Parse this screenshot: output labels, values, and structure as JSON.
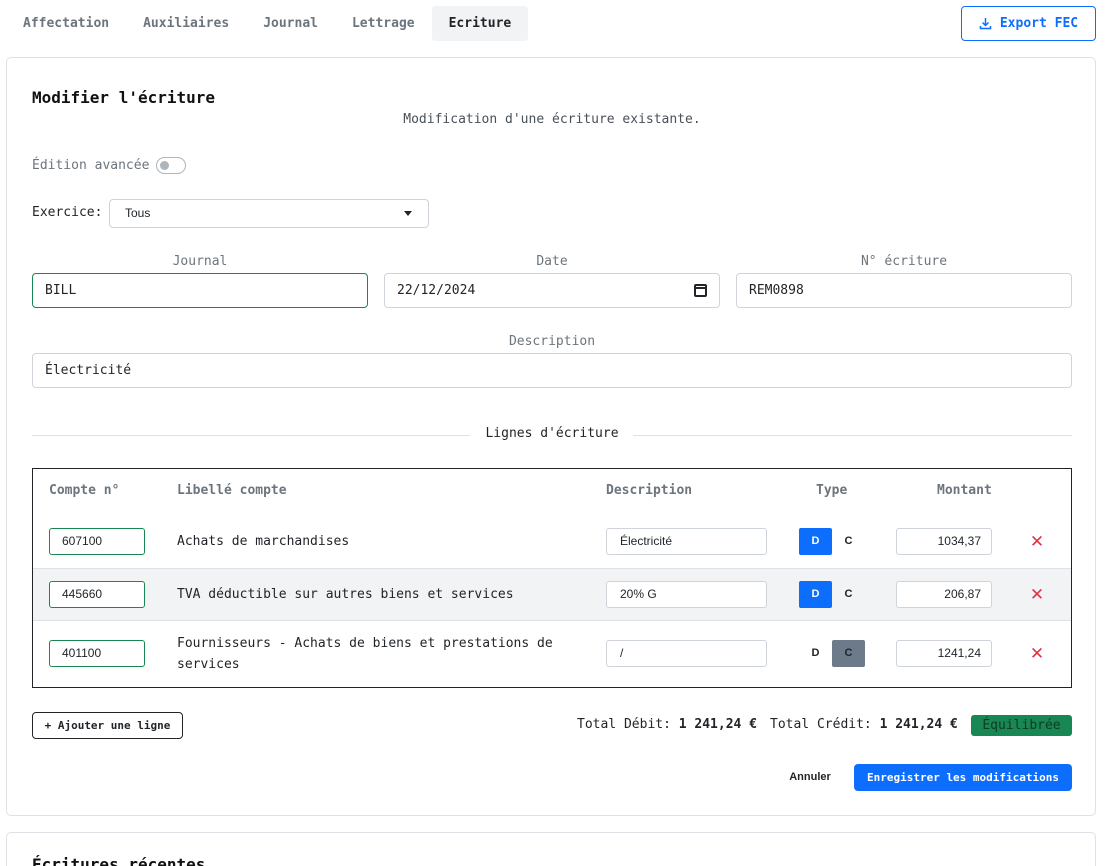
{
  "tabs": [
    "Affectation",
    "Auxiliaires",
    "Journal",
    "Lettrage",
    "Ecriture"
  ],
  "active_tab": "Ecriture",
  "export_label": "Export FEC",
  "form": {
    "title": "Modifier l'écriture",
    "subtitle": "Modification d'une écriture existante.",
    "advanced_label": "Édition avancée",
    "exercice_label": "Exercice:",
    "exercice_value": "Tous",
    "journal_label": "Journal",
    "journal_value": "BILL",
    "date_label": "Date",
    "date_value": "22/12/2024",
    "num_label": "N° écriture",
    "num_value": "REM0898",
    "description_label": "Description",
    "description_value": "Électricité",
    "lines_label": "Lignes d'écriture"
  },
  "table": {
    "headers": [
      "Compte n°",
      "Libellé compte",
      "Description",
      "Type",
      "Montant"
    ],
    "rows": [
      {
        "compte": "607100",
        "libelle": "Achats de marchandises",
        "description": "Électricité",
        "type_selected": "D",
        "montant": "1034,37"
      },
      {
        "compte": "445660",
        "libelle": "TVA déductible sur autres biens et services",
        "description": "20% G",
        "type_selected": "D",
        "montant": "206,87"
      },
      {
        "compte": "401100",
        "libelle": "Fournisseurs - Achats de biens et prestations de services",
        "description": "/",
        "type_selected": "C",
        "montant": "1241,24"
      }
    ],
    "type_d": "D",
    "type_c": "C",
    "delete_glyph": "✕"
  },
  "add_line_label": "+ Ajouter une ligne",
  "totals": {
    "debit_label": "Total Débit:",
    "debit_value": "1 241,24 €",
    "credit_label": "Total Crédit:",
    "credit_value": "1 241,24 €",
    "status": "Équilibrée"
  },
  "cancel_label": "Annuler",
  "save_label": "Enregistrer les modifications",
  "next_card_title": "Écritures récentes",
  "colors": {
    "primary": "#0d6efd",
    "success": "#198754",
    "danger": "#dc3545"
  }
}
